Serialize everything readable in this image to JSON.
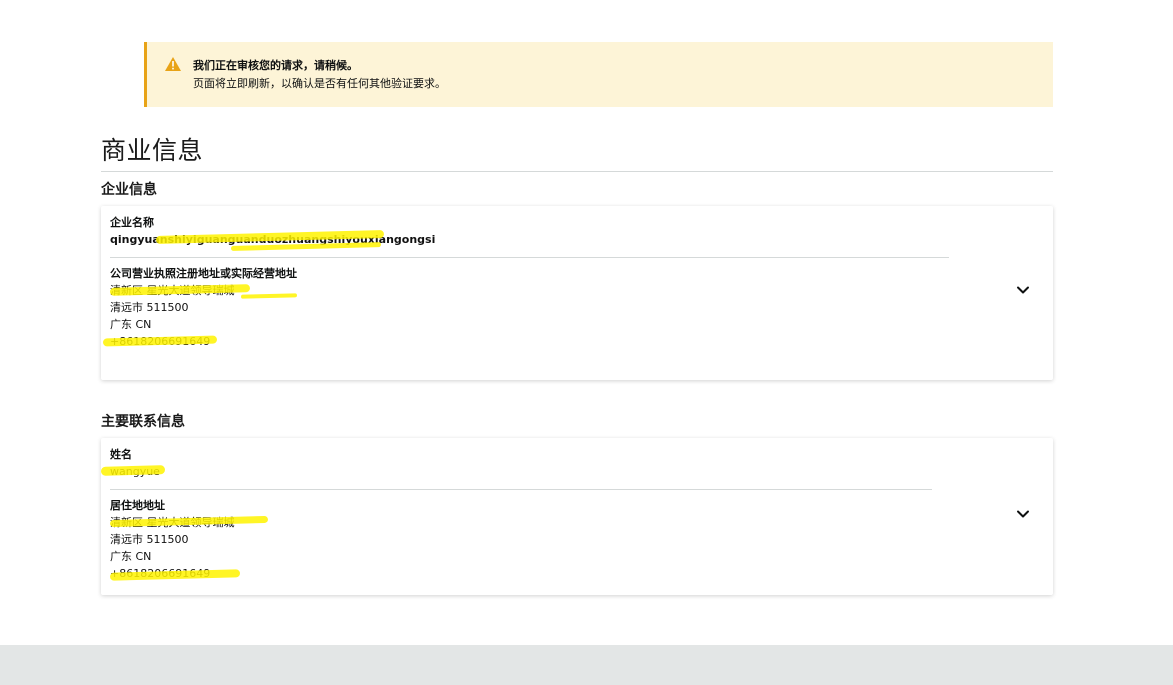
{
  "alert": {
    "title": "我们正在审核您的请求，请稍候。",
    "message": "页面将立即刷新，以确认是否有任何其他验证要求。",
    "accent_color": "#e8a317",
    "background": "#fdf4d7"
  },
  "page": {
    "title": "商业信息"
  },
  "business": {
    "section_title": "企业信息",
    "company_name_label": "企业名称",
    "company_name_value": "qingyuanshiyiguanguanduozhuangshiyouxiangongsi",
    "address_label": "公司营业执照注册地址或实际经营地址",
    "address_lines": [
      "清新区 星光大道领导瑞城",
      "清远市 511500",
      "广东 CN",
      "+8618206691649"
    ]
  },
  "contact": {
    "section_title": "主要联系信息",
    "name_label": "姓名",
    "name_value": "wangyue",
    "address_label": "居住地地址",
    "address_lines": [
      "清新区 星光大道领导瑞城",
      "清远市 511500",
      "广东 CN",
      "+8618206691649"
    ]
  },
  "icons": {
    "alert": "warning-triangle-icon",
    "expand": "chevron-down-icon"
  }
}
